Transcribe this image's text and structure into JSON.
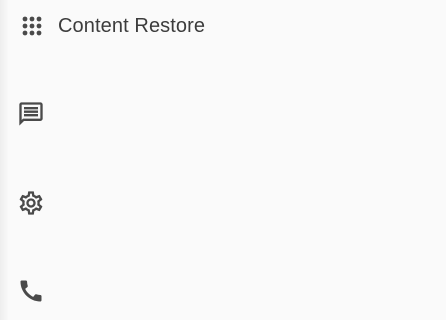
{
  "app": {
    "title": "Content Restore"
  },
  "header": {
    "apps_icon": "apps-grid-icon"
  },
  "rail": {
    "items": [
      {
        "icon": "message-icon"
      },
      {
        "icon": "settings-gear-icon"
      },
      {
        "icon": "phone-icon"
      }
    ]
  },
  "colors": {
    "icon": "#4a4a4a",
    "text": "#3c3c3c",
    "background": "#fafafa"
  }
}
